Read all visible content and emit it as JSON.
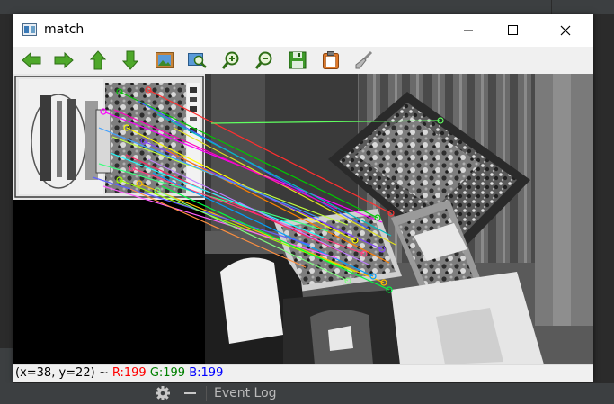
{
  "window": {
    "title": "match"
  },
  "toolbar": {
    "buttons": [
      {
        "name": "pan-left-button",
        "icon": "arrow-left-icon"
      },
      {
        "name": "pan-right-button",
        "icon": "arrow-right-icon"
      },
      {
        "name": "pan-up-button",
        "icon": "arrow-up-icon"
      },
      {
        "name": "pan-down-button",
        "icon": "arrow-down-icon"
      },
      {
        "name": "zoom-fit-button",
        "icon": "picture-icon"
      },
      {
        "name": "zoom-original-button",
        "icon": "zoom-image-icon"
      },
      {
        "name": "zoom-in-button",
        "icon": "zoom-in-icon"
      },
      {
        "name": "zoom-out-button",
        "icon": "zoom-out-icon"
      },
      {
        "name": "save-button",
        "icon": "floppy-disk-icon"
      },
      {
        "name": "copy-button",
        "icon": "clipboard-icon"
      },
      {
        "name": "properties-button",
        "icon": "brush-icon"
      }
    ]
  },
  "status": {
    "coords": "(x=38, y=22) ~",
    "r_label": "R:199",
    "g_label": "G:199",
    "b_label": "B:199",
    "colors": {
      "r": "#ff0000",
      "g": "#008000",
      "b": "#0000ff"
    }
  },
  "ide": {
    "event_log": "Event Log"
  }
}
